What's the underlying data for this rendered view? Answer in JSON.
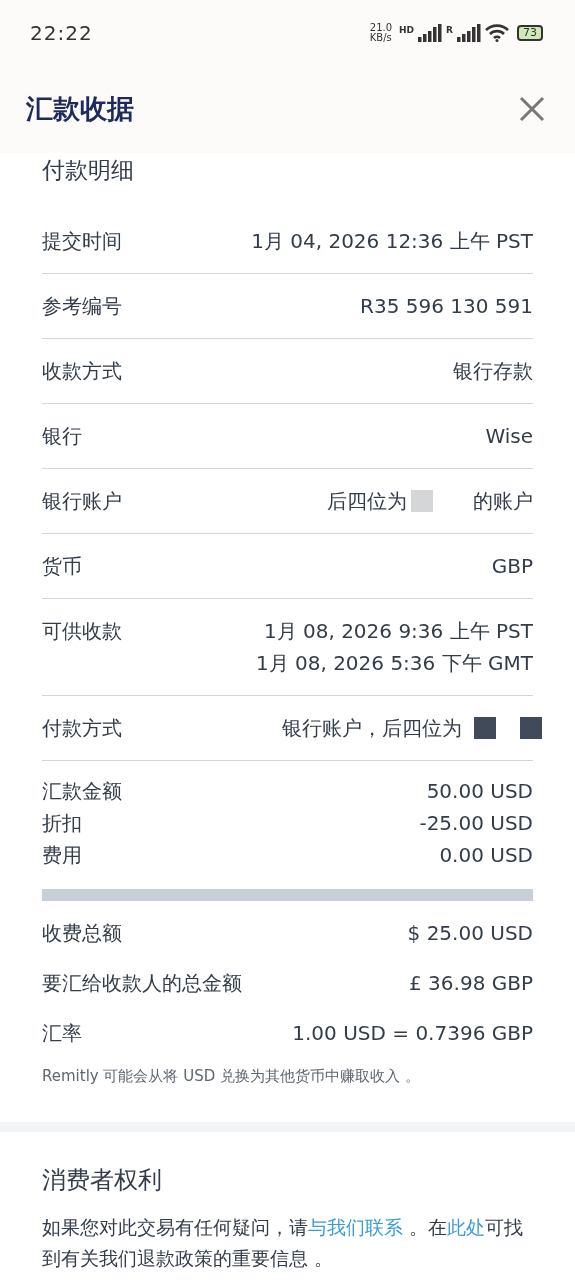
{
  "status_bar": {
    "time": "22:22",
    "net_speed": [
      "21.0",
      "KB/s"
    ],
    "sim1_label": "HD",
    "sim2_label": "R",
    "battery": "73"
  },
  "header": {
    "title": "汇款收据"
  },
  "details": {
    "heading": "付款明细",
    "rows": [
      {
        "label": "提交时间",
        "value": [
          "1月 04, 2026 12:36 上午 PST"
        ]
      },
      {
        "label": "参考编号",
        "value": [
          "R35 596 130 591"
        ]
      },
      {
        "label": "收款方式",
        "value": [
          "银行存款"
        ]
      },
      {
        "label": "银行",
        "value": [
          "Wise"
        ]
      },
      {
        "label": "银行账户",
        "value": [
          "后四位为"
        ],
        "kind": "masked_light",
        "suffix": "的账户"
      },
      {
        "label": "货币",
        "value": [
          "GBP"
        ]
      },
      {
        "label": "可供收款",
        "value": [
          "1月 08, 2026 9:36 上午 PST",
          "1月 08, 2026 5:36 下午 GMT"
        ]
      },
      {
        "label": "付款方式",
        "value": [
          "银行账户，后四位为"
        ],
        "kind": "masked_dark"
      }
    ],
    "amounts": [
      {
        "label": "汇款金额",
        "value": "50.00 USD"
      },
      {
        "label": "折扣",
        "value": "-25.00 USD"
      },
      {
        "label": "费用",
        "value": "0.00 USD"
      }
    ],
    "totals": [
      {
        "label": "收费总额",
        "value": "$ 25.00 USD"
      },
      {
        "label": "要汇给收款人的总金额",
        "value": "£ 36.98 GBP"
      },
      {
        "label": "汇率",
        "value": "1.00 USD = 0.7396 GBP"
      }
    ],
    "note": "Remitly 可能会从将 USD 兑换为其他货币中赚取收入 。"
  },
  "rights": {
    "heading": "消费者权利",
    "parts": [
      {
        "kind": "text",
        "text": "如果您对此交易有任何疑问，请"
      },
      {
        "kind": "link",
        "text": "与我们联系"
      },
      {
        "kind": "text",
        "text": " 。在"
      },
      {
        "kind": "link",
        "text": "此处"
      },
      {
        "kind": "text",
        "text": "可找到有关我们退款政策的重要信息 。"
      }
    ]
  }
}
